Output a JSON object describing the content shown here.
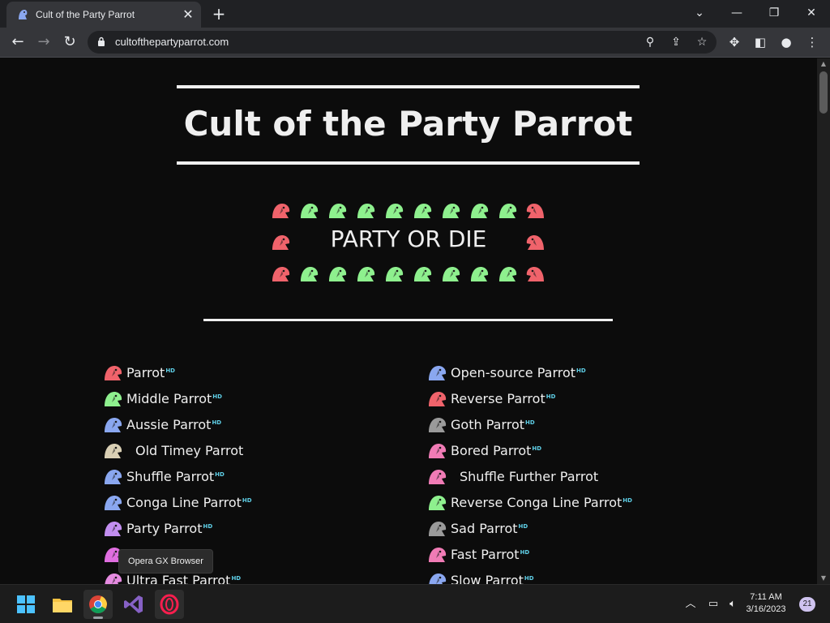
{
  "browser": {
    "tab_title": "Cult of the Party Parrot",
    "url": "cultofthepartyparrot.com"
  },
  "page": {
    "title": "Cult of the Party Parrot",
    "party_text": "PARTY OR DIE",
    "hd_badge": "HD",
    "parrot_colors": {
      "red": "#f0636b",
      "green": "#8ef08e"
    },
    "left_list": [
      {
        "label": "Parrot",
        "hd": true,
        "icon": "red-parrot-icon",
        "color": "#f0636b"
      },
      {
        "label": "Middle Parrot",
        "hd": true,
        "icon": "green-parrot-icon",
        "color": "#8ef08e"
      },
      {
        "label": "Aussie Parrot",
        "hd": true,
        "icon": "upside-down-parrot-icon",
        "color": "#8aa7f0"
      },
      {
        "label": "Old Timey Parrot",
        "hd": false,
        "icon": "sepia-parrot-icon",
        "color": "#d9cfb4"
      },
      {
        "label": "Shuffle Parrot",
        "hd": true,
        "icon": "blue-parrot-icon",
        "color": "#8aa7f0"
      },
      {
        "label": "Conga Line Parrot",
        "hd": true,
        "icon": "conga-parrot-icon",
        "color": "#8aa7f0"
      },
      {
        "label": "Party Parrot",
        "hd": true,
        "icon": "purple-parrot-icon",
        "color": "#c28ef0"
      },
      {
        "label": "",
        "hd": false,
        "icon": "magenta-parrot-icon",
        "color": "#e06ee0"
      },
      {
        "label": "Ultra Fast Parrot",
        "hd": true,
        "icon": "pink-parrot-icon",
        "color": "#e58be0"
      }
    ],
    "right_list": [
      {
        "label": "Open-source Parrot",
        "hd": true,
        "icon": "opensource-parrot-icon",
        "color": "#8aa7f0"
      },
      {
        "label": "Reverse Parrot",
        "hd": true,
        "icon": "reverse-parrot-icon",
        "color": "#f0636b"
      },
      {
        "label": "Goth Parrot",
        "hd": true,
        "icon": "goth-parrot-icon",
        "color": "#9a9a9a"
      },
      {
        "label": "Bored Parrot",
        "hd": true,
        "icon": "bored-parrot-icon",
        "color": "#f07bb5"
      },
      {
        "label": "Shuffle Further Parrot",
        "hd": false,
        "icon": "shuffle-further-parrot-icon",
        "color": "#f07bb5"
      },
      {
        "label": "Reverse Conga Line Parrot",
        "hd": true,
        "icon": "reverse-conga-parrot-icon",
        "color": "#8ef08e"
      },
      {
        "label": "Sad Parrot",
        "hd": true,
        "icon": "sad-parrot-icon",
        "color": "#9a9a9a"
      },
      {
        "label": "Fast Parrot",
        "hd": true,
        "icon": "fast-parrot-icon",
        "color": "#f07bb5"
      },
      {
        "label": "Slow Parrot",
        "hd": true,
        "icon": "slow-parrot-icon",
        "color": "#8aa7f0"
      }
    ]
  },
  "tooltip": "Opera GX Browser",
  "taskbar": {
    "time": "7:11 AM",
    "date": "3/16/2023",
    "notification_count": "21"
  }
}
